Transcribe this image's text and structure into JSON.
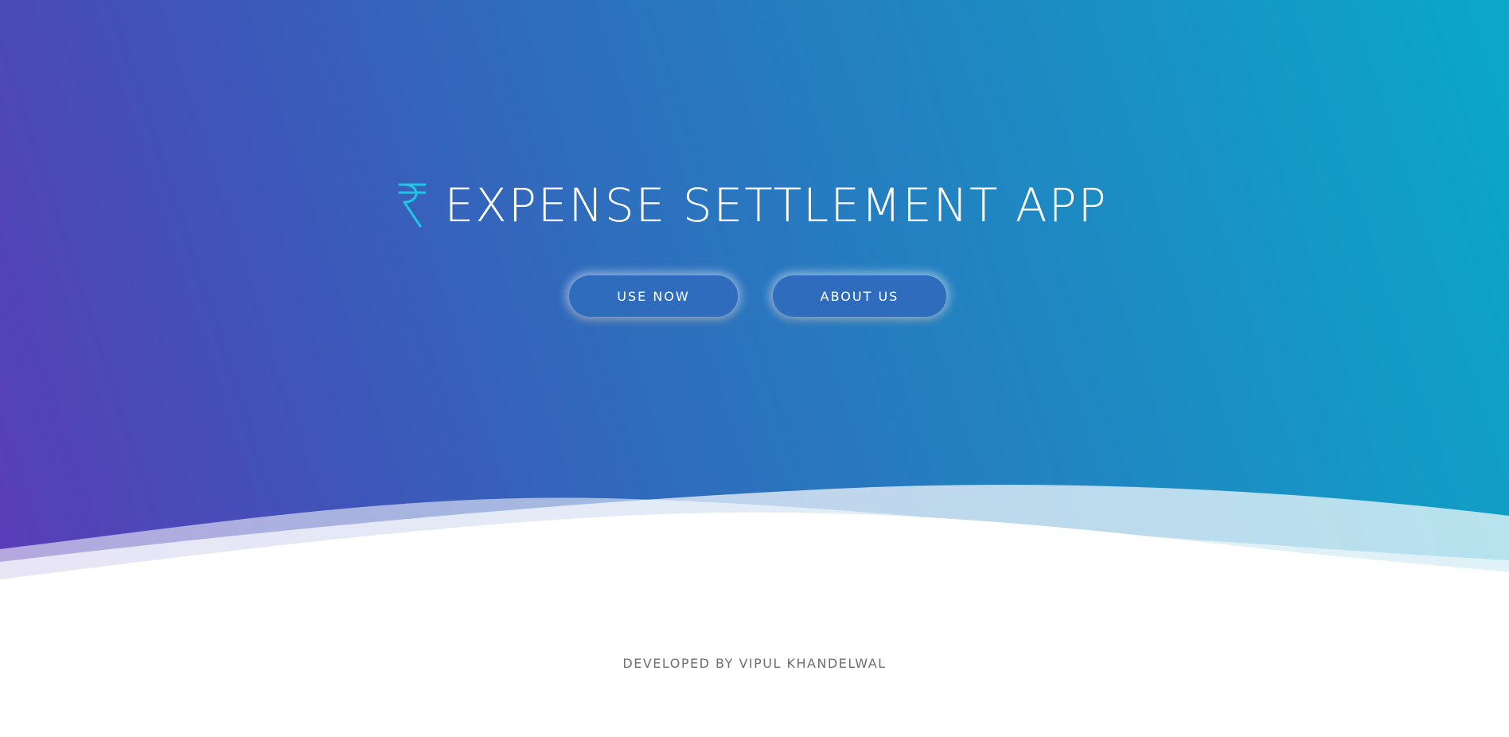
{
  "hero": {
    "title": "EXPENSE SETTLEMENT APP",
    "icon": "rupee-icon",
    "icon_color": "#1ec6e0",
    "gradient_start": "#5a3db8",
    "gradient_end": "#0aa8c8"
  },
  "buttons": {
    "use_now": "USE NOW",
    "about_us": "ABOUT US",
    "button_color": "#2f6cbd"
  },
  "footer": {
    "credit": "DEVELOPED BY VIPUL KHANDELWAL"
  }
}
